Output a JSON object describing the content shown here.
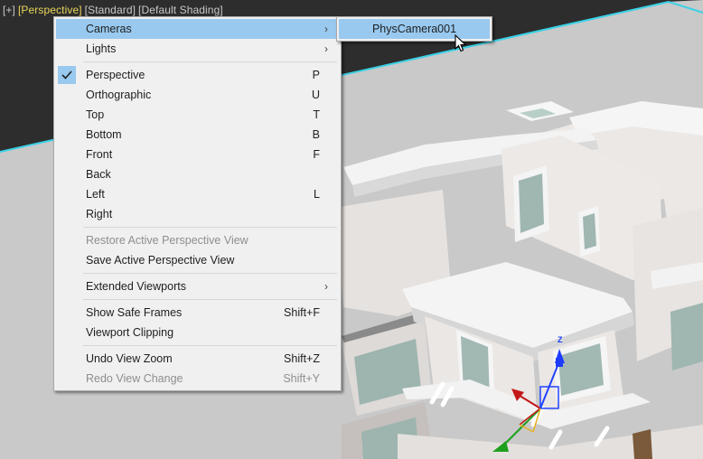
{
  "viewport": {
    "label_plus": "[+]",
    "label_view": "[Perspective]",
    "label_mode": "[Standard]",
    "label_shading": "[Default Shading]"
  },
  "menu": {
    "cameras": "Cameras",
    "lights": "Lights",
    "perspective": {
      "label": "Perspective",
      "shortcut": "P"
    },
    "orthographic": {
      "label": "Orthographic",
      "shortcut": "U"
    },
    "top": {
      "label": "Top",
      "shortcut": "T"
    },
    "bottom": {
      "label": "Bottom",
      "shortcut": "B"
    },
    "front": {
      "label": "Front",
      "shortcut": "F"
    },
    "back": {
      "label": "Back"
    },
    "left": {
      "label": "Left",
      "shortcut": "L"
    },
    "right": {
      "label": "Right"
    },
    "restore_perspective": "Restore Active Perspective View",
    "save_perspective": "Save Active Perspective View",
    "extended_viewports": "Extended Viewports",
    "show_safe_frames": {
      "label": "Show Safe Frames",
      "shortcut": "Shift+F"
    },
    "viewport_clipping": "Viewport Clipping",
    "undo_view_zoom": {
      "label": "Undo View Zoom",
      "shortcut": "Shift+Z"
    },
    "redo_view_change": {
      "label": "Redo View Change",
      "shortcut": "Shift+Y"
    }
  },
  "submenu": {
    "camera_item": "PhysCamera001"
  },
  "gizmo": {
    "z_label": "Z"
  },
  "colors": {
    "highlight": "#99c9ef",
    "viewport_border": "#3ad1e6",
    "active_label": "#e8d65a"
  }
}
